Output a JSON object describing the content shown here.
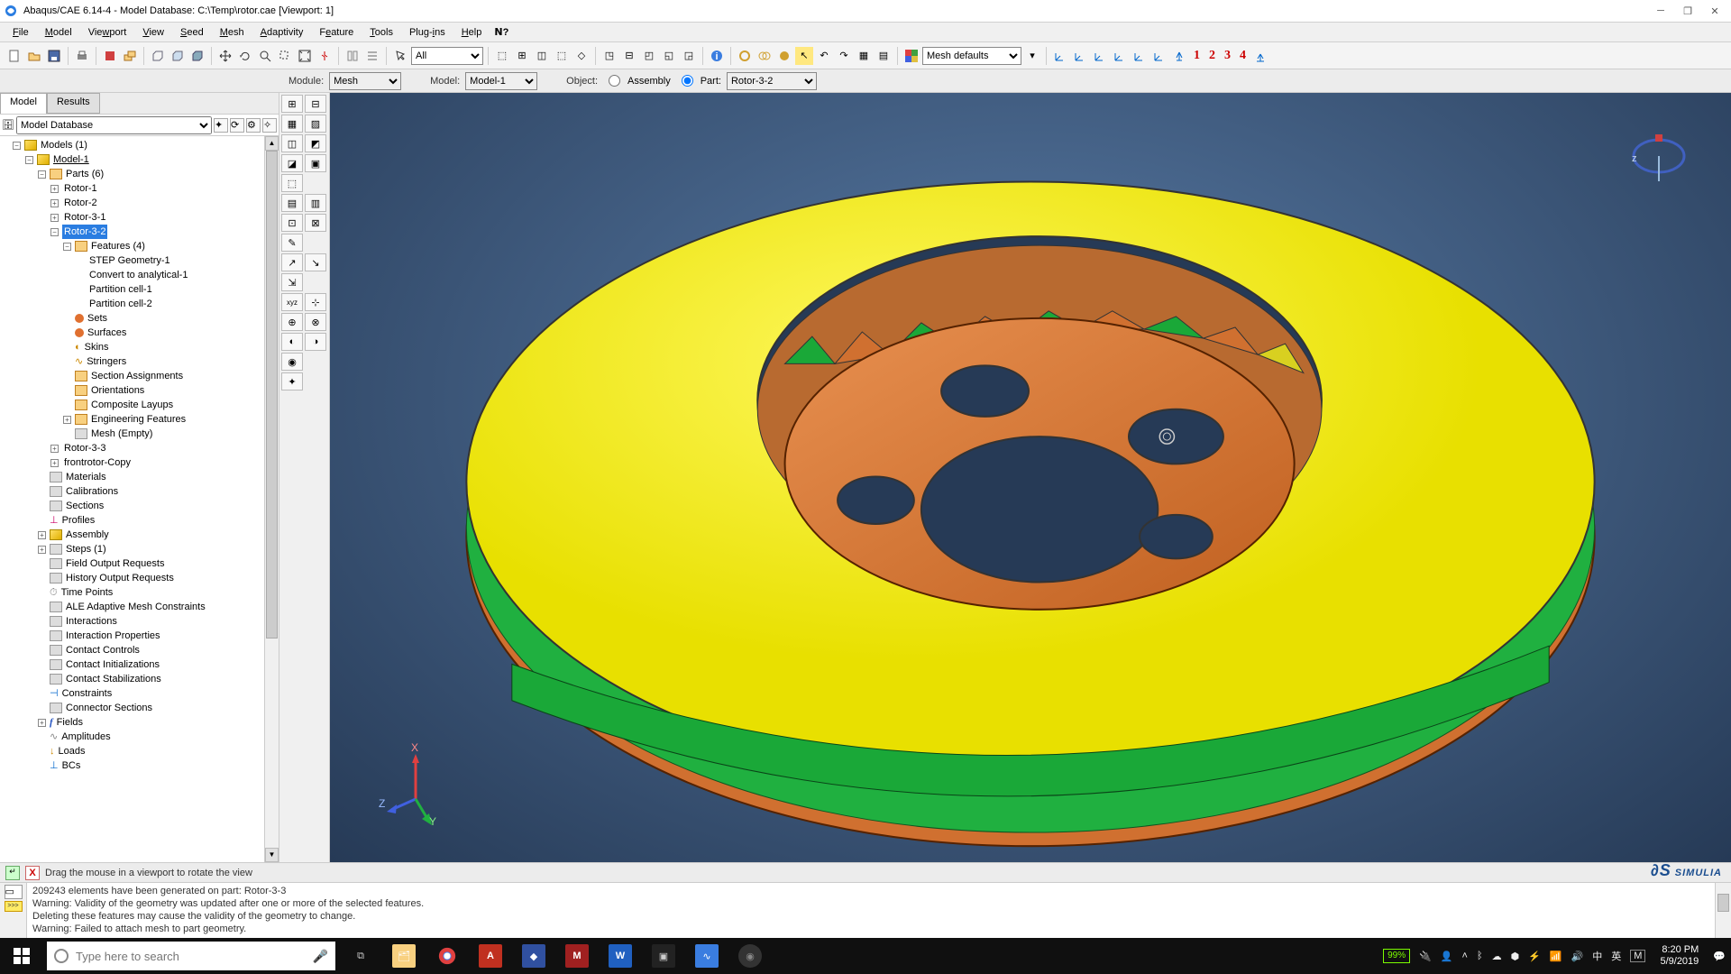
{
  "window": {
    "title": "Abaqus/CAE 6.14-4 - Model Database: C:\\Temp\\rotor.cae [Viewport: 1]"
  },
  "menus": [
    "File",
    "Model",
    "Viewport",
    "View",
    "Seed",
    "Mesh",
    "Adaptivity",
    "Feature",
    "Tools",
    "Plug-ins",
    "Help"
  ],
  "toolbar_all_dropdown": "All",
  "toolbar_mesh_defaults": "Mesh defaults",
  "context": {
    "module_label": "Module:",
    "module_value": "Mesh",
    "model_label": "Model:",
    "model_value": "Model-1",
    "object_label": "Object:",
    "assembly_label": "Assembly",
    "part_label": "Part:",
    "part_value": "Rotor-3-2"
  },
  "tabs": {
    "model": "Model",
    "results": "Results"
  },
  "tree_header_value": "Model Database",
  "tree": {
    "root": "Models (1)",
    "model": "Model-1",
    "parts": "Parts (6)",
    "part_items": [
      "Rotor-1",
      "Rotor-2",
      "Rotor-3-1",
      "Rotor-3-2",
      "Rotor-3-3",
      "frontrotor-Copy"
    ],
    "features": "Features (4)",
    "feature_items": [
      "STEP Geometry-1",
      "Convert to analytical-1",
      "Partition cell-1",
      "Partition cell-2"
    ],
    "sets": "Sets",
    "surfaces": "Surfaces",
    "skins": "Skins",
    "stringers": "Stringers",
    "section_assignments": "Section Assignments",
    "orientations": "Orientations",
    "composite_layups": "Composite Layups",
    "eng_features": "Engineering Features",
    "mesh_empty": "Mesh (Empty)",
    "materials": "Materials",
    "calibrations": "Calibrations",
    "sections": "Sections",
    "profiles": "Profiles",
    "assembly": "Assembly",
    "steps": "Steps (1)",
    "field_output": "Field Output Requests",
    "history_output": "History Output Requests",
    "time_points": "Time Points",
    "ale": "ALE Adaptive Mesh Constraints",
    "interactions": "Interactions",
    "interaction_props": "Interaction Properties",
    "contact_controls": "Contact Controls",
    "contact_init": "Contact Initializations",
    "contact_stab": "Contact Stabilizations",
    "constraints": "Constraints",
    "connector_sections": "Connector Sections",
    "fields": "Fields",
    "amplitudes": "Amplitudes",
    "loads": "Loads",
    "bcs": "BCs"
  },
  "prompt": "Drag the mouse in a viewport to rotate the view",
  "brand": "SIMULIA",
  "messages": [
    "209243 elements have been generated on part: Rotor-3-3",
    "Warning: Validity of the geometry was updated after one or more of the selected features.",
    "Deleting these features may cause the validity of the geometry to change.",
    "Warning: Failed to attach mesh to part geometry."
  ],
  "taskbar": {
    "search_placeholder": "Type here to search",
    "battery": "99%",
    "ime": [
      "中",
      "英",
      "M"
    ],
    "time": "8:20 PM",
    "date": "5/9/2019"
  },
  "axes": {
    "x": "X",
    "y": "Y",
    "z": "Z"
  }
}
